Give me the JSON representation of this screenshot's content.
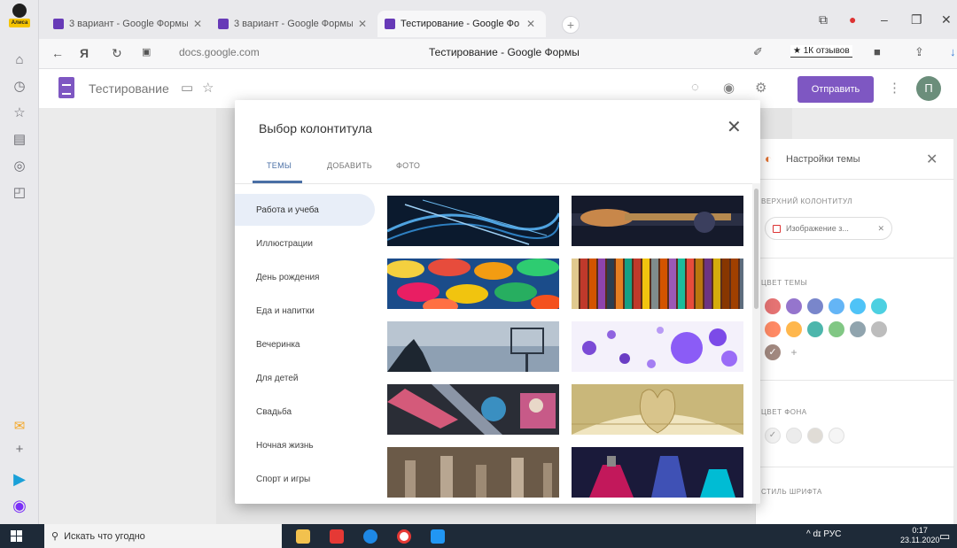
{
  "browser": {
    "tabs": [
      {
        "label": "3 вариант - Google Формы"
      },
      {
        "label": "3 вариант - Google Формы"
      },
      {
        "label": "Тестирование - Google Фо"
      }
    ],
    "url": "docs.google.com",
    "page_title": "Тестирование - Google Формы",
    "reviews_label": "★ 1К отзывов",
    "avatar_badge": "Алиса"
  },
  "forms": {
    "title": "Тестирование",
    "send_label": "Отправить",
    "user_initial": "П"
  },
  "modal": {
    "title": "Выбор колонтитула",
    "close_glyph": "✕",
    "tabs": [
      {
        "label": "ТЕМЫ"
      },
      {
        "label": "ДОБАВИТЬ"
      },
      {
        "label": "ФОТО"
      }
    ],
    "categories": [
      {
        "label": "Работа и учеба"
      },
      {
        "label": "Иллюстрации"
      },
      {
        "label": "День рождения"
      },
      {
        "label": "Еда и напитки"
      },
      {
        "label": "Вечеринка"
      },
      {
        "label": "Для детей"
      },
      {
        "label": "Свадьба"
      },
      {
        "label": "Ночная жизнь"
      },
      {
        "label": "Спорт и игры"
      }
    ]
  },
  "theme_panel": {
    "title": "Настройки темы",
    "header_label": "ВЕРХНИЙ КОЛОНТИТУЛ",
    "header_chip": "Изображение з...",
    "theme_color_label": "ЦВЕТ ТЕМЫ",
    "bg_color_label": "ЦВЕТ ФОНА",
    "font_label": "СТИЛЬ ШРИФТА",
    "theme_colors": [
      "#e57373",
      "#9575cd",
      "#7986cb",
      "#64b5f6",
      "#4fc3f7",
      "#4dd0e1",
      "#ff8a65",
      "#ffb74d",
      "#4db6ac",
      "#81c784",
      "#90a4ae",
      "#bdbdbd",
      "#a1887f"
    ],
    "bg_colors": [
      "#f1f1f1",
      "#ececec",
      "#e0dcd6",
      "#f5f5f5"
    ]
  },
  "taskbar": {
    "search_placeholder": "Искать что угодно",
    "tray_text": "^ dɪ РУС",
    "time": "0:17",
    "date": "23.11.2020"
  }
}
